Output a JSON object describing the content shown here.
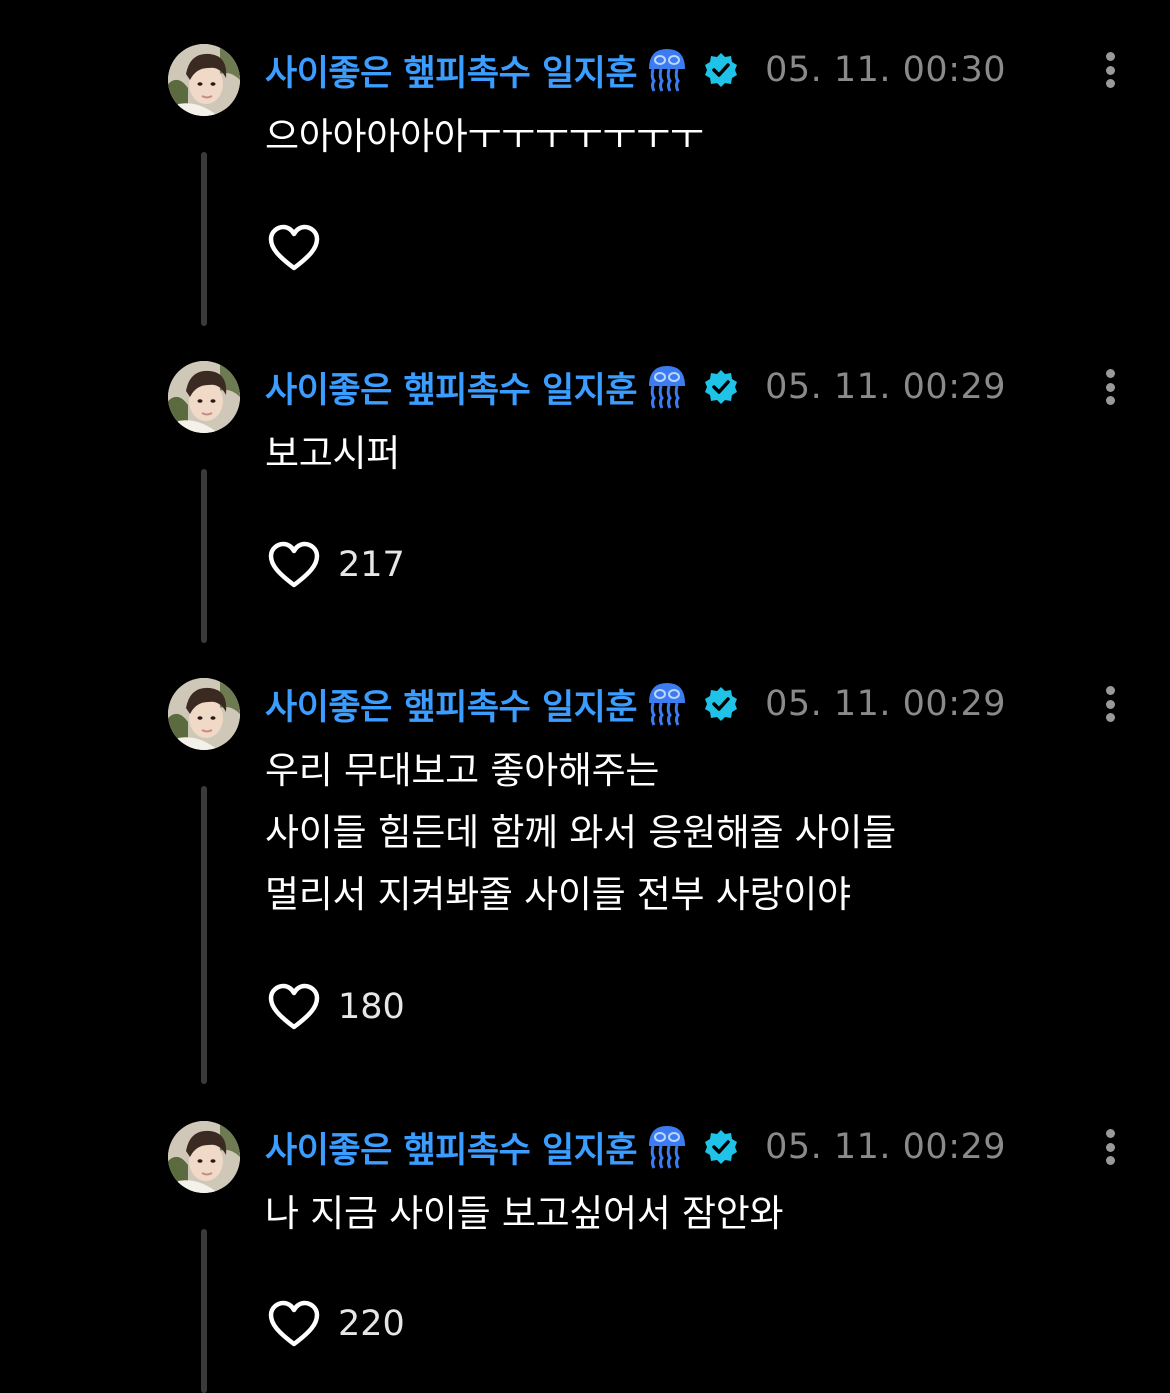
{
  "posts": [
    {
      "username": "사이좋은 햎피촉수 일지훈",
      "emoji": "jellyfish-icon",
      "verified": "verified-badge-icon",
      "timestamp": "05. 11. 00:30",
      "text": "으아아아아아ㅜㅜㅜㅜㅜㅜㅜ",
      "likes": ""
    },
    {
      "username": "사이좋은 햎피촉수 일지훈",
      "emoji": "jellyfish-icon",
      "verified": "verified-badge-icon",
      "timestamp": "05. 11. 00:29",
      "text": "보고시퍼",
      "likes": "217"
    },
    {
      "username": "사이좋은 햎피촉수 일지훈",
      "emoji": "jellyfish-icon",
      "verified": "verified-badge-icon",
      "timestamp": "05. 11. 00:29",
      "text": "우리 무대보고 좋아해주는\n사이들 힘든데 함께 와서 응원해줄 사이들\n멀리서 지켜봐줄 사이들 전부 사랑이야",
      "likes": "180"
    },
    {
      "username": "사이좋은 햎피촉수 일지훈",
      "emoji": "jellyfish-icon",
      "verified": "verified-badge-icon",
      "timestamp": "05. 11. 00:29",
      "text": "나 지금 사이들 보고싶어서 잠안와",
      "likes": "220"
    }
  ],
  "colors": {
    "background": "#000000",
    "username": "#3b9dff",
    "verified": "#1fc3e8",
    "timestamp": "#8a8a8a",
    "thread_line": "#3a3a3a"
  }
}
